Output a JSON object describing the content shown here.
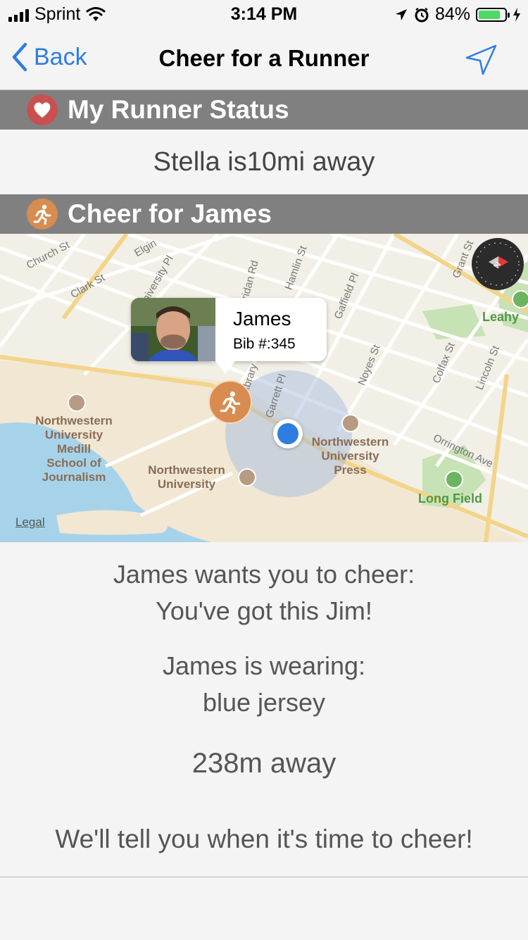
{
  "status_bar": {
    "carrier": "Sprint",
    "time": "3:14 PM",
    "battery": "84%",
    "battery_level": 0.84
  },
  "nav": {
    "back_label": "Back",
    "title": "Cheer for a Runner",
    "location_icon": "location-arrow-icon"
  },
  "runner_status": {
    "header": "My Runner Status",
    "header_icon": "heart-icon",
    "text": "Stella is10mi away"
  },
  "cheer_section": {
    "header": "Cheer for James",
    "header_icon": "runner-icon"
  },
  "map": {
    "legal": "Legal",
    "callout": {
      "name": "James",
      "bib": "Bib #:345"
    },
    "streets": [
      "Church St",
      "Elgin",
      "Clark St",
      "University Pl",
      "Sheridan Rd",
      "Hamlin St",
      "Gaffield Pl",
      "Grant St",
      "Colfax St",
      "Lincoln St",
      "Noyes St",
      "Garrett Pl",
      "Library Pl",
      "Orrington Ave"
    ],
    "places": {
      "medill": [
        "Northwestern",
        "University",
        "Medill",
        "School of",
        "Journalism"
      ],
      "nu": [
        "Northwestern",
        "University"
      ],
      "nu_press": [
        "Northwestern",
        "University",
        "Press"
      ],
      "leahy": "Leahy",
      "long_field": "Long Field"
    }
  },
  "cheer": {
    "wants_line1": "James wants you to cheer:",
    "wants_line2": "You've got this Jim!",
    "wearing_line1": "James is wearing:",
    "wearing_line2": "blue jersey",
    "distance": "238m away",
    "notice": "We'll tell you when it's time to cheer!"
  },
  "colors": {
    "accent": "#2f7de1",
    "header_bg": "#808080",
    "runner_orange": "#d98c4f",
    "heart_red": "#c95050",
    "user_dot": "#2f7de1"
  }
}
